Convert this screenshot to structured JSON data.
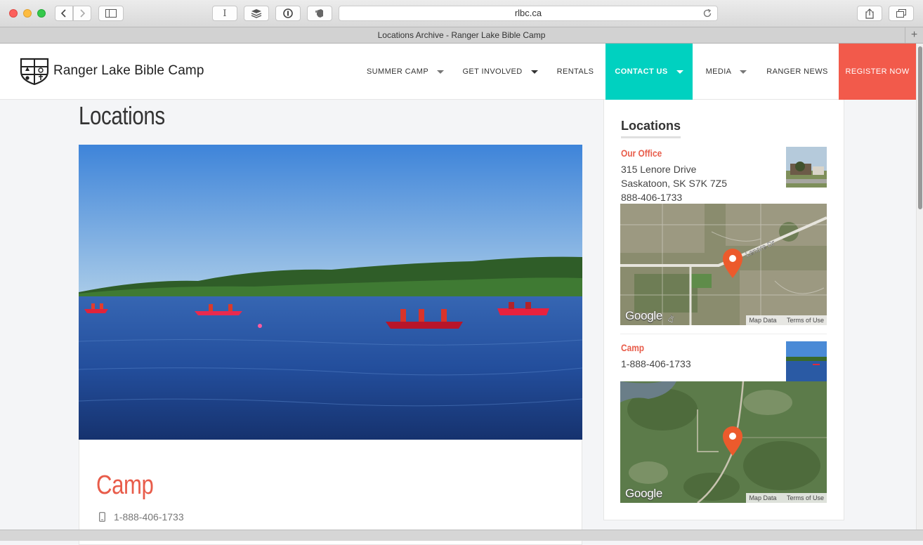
{
  "browser": {
    "url": "rlbc.ca",
    "tab_title": "Locations Archive - Ranger Lake Bible Camp",
    "reader_glyph": "I"
  },
  "site": {
    "logo_text": "Ranger Lake Bible Camp",
    "nav": [
      {
        "label": "SUMMER CAMP",
        "has_dropdown": true
      },
      {
        "label": "GET INVOLVED",
        "has_dropdown": true
      },
      {
        "label": "RENTALS",
        "has_dropdown": false
      },
      {
        "label": "CONTACT US",
        "has_dropdown": true,
        "active": true
      },
      {
        "label": "MEDIA",
        "has_dropdown": true
      },
      {
        "label": "RANGER NEWS",
        "has_dropdown": false
      },
      {
        "label": "REGISTER NOW",
        "has_dropdown": false
      }
    ],
    "accent_color": "#00d1c0",
    "register_color": "#f25a4b",
    "heading_color": "#e85c4a"
  },
  "main": {
    "page_title": "Locations",
    "card": {
      "title": "Camp",
      "phone": "1-888-406-1733"
    }
  },
  "sidebar": {
    "title": "Locations",
    "locations": [
      {
        "name": "Our Office",
        "address1": "315 Lenore Drive",
        "address2": "Saskatoon, SK S7K 7Z5",
        "phone": "888-406-1733",
        "map_street_label": "Lenore Dr",
        "map_street_label_2": "Dr"
      },
      {
        "name": "Camp",
        "phone": "1-888-406-1733"
      }
    ],
    "map_attr": {
      "data": "Map Data",
      "terms": "Terms of Use",
      "brand": "Google"
    }
  }
}
